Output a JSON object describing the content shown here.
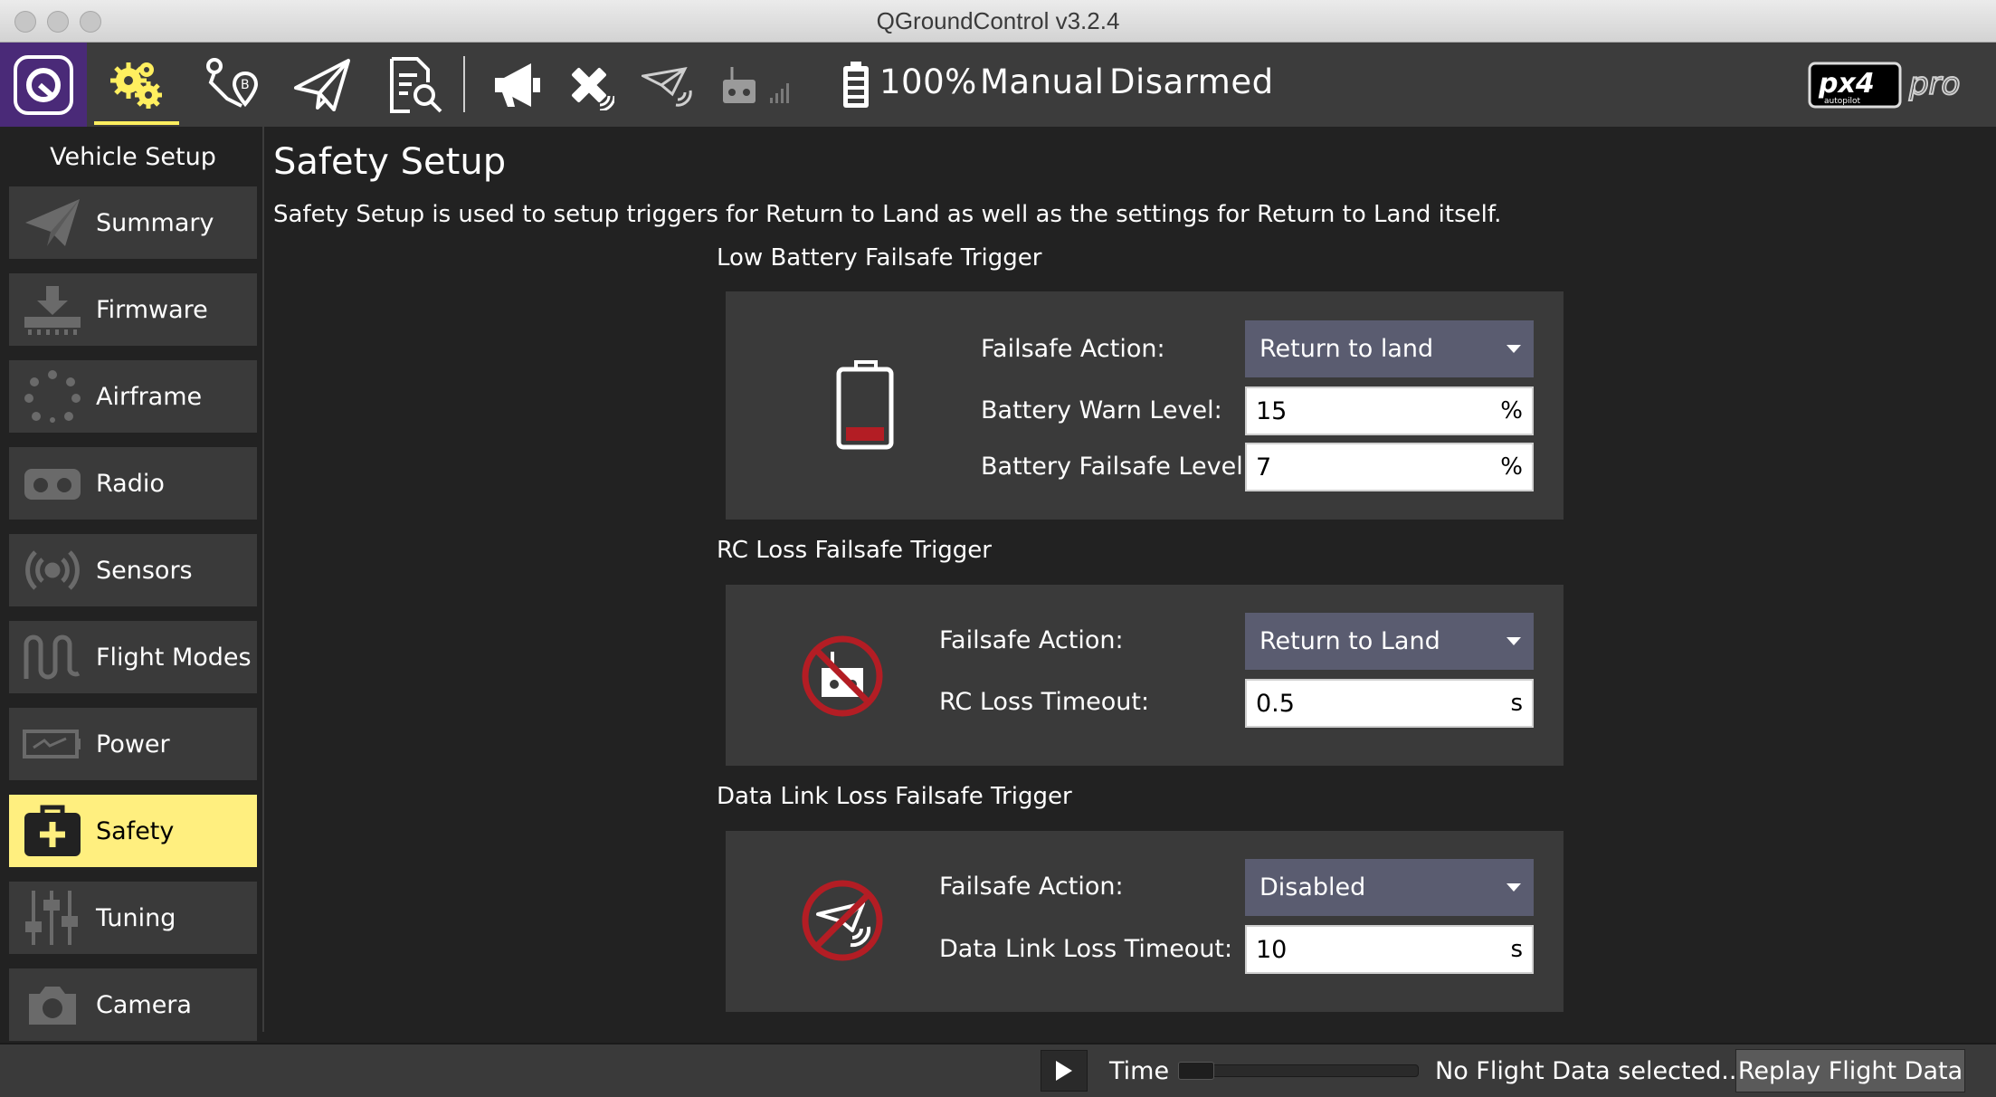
{
  "window": {
    "title": "QGroundControl v3.2.4"
  },
  "toolbar": {
    "battery_percent": "100%",
    "flight_mode": "Manual",
    "arm_state": "Disarmed",
    "brand_logo_text": "px4 autopilot pro",
    "icons": [
      "qgc-logo-icon",
      "vehicle-setup-gears-icon",
      "plan-waypoint-icon",
      "fly-paper-plane-icon",
      "analyze-document-icon",
      "messages-megaphone-icon",
      "gps-satellite-icon",
      "telemetry-plane-icon",
      "rc-transmitter-icon",
      "battery-icon"
    ],
    "accent": "#ffef5f"
  },
  "sidebar": {
    "title": "Vehicle Setup",
    "items": [
      {
        "label": "Summary",
        "icon": "paper-plane-icon"
      },
      {
        "label": "Firmware",
        "icon": "download-chip-icon"
      },
      {
        "label": "Airframe",
        "icon": "airframe-dots-icon"
      },
      {
        "label": "Radio",
        "icon": "radio-transmitter-icon"
      },
      {
        "label": "Sensors",
        "icon": "sensors-waves-icon"
      },
      {
        "label": "Flight Modes",
        "icon": "flight-modes-wave-icon"
      },
      {
        "label": "Power",
        "icon": "power-battery-icon"
      },
      {
        "label": "Safety",
        "icon": "safety-medkit-icon",
        "active": true
      },
      {
        "label": "Tuning",
        "icon": "tuning-sliders-icon"
      },
      {
        "label": "Camera",
        "icon": "camera-icon"
      }
    ],
    "active_color": "#ffef7f"
  },
  "main": {
    "title": "Safety Setup",
    "description": "Safety Setup is used to setup triggers for Return to Land as well as the settings for Return to Land itself.",
    "sections": {
      "battery": {
        "title": "Low Battery Failsafe Trigger",
        "action_label": "Failsafe Action:",
        "action_value": "Return to land",
        "warn_label": "Battery Warn Level:",
        "warn_value": "15",
        "warn_unit": "%",
        "failsafe_label": "Battery Failsafe Level:",
        "failsafe_value": "7",
        "failsafe_unit": "%"
      },
      "rc_loss": {
        "title": "RC Loss Failsafe Trigger",
        "action_label": "Failsafe Action:",
        "action_value": "Return to Land",
        "timeout_label": "RC Loss Timeout:",
        "timeout_value": "0.5",
        "timeout_unit": "s"
      },
      "datalink": {
        "title": "Data Link Loss Failsafe Trigger",
        "action_label": "Failsafe Action:",
        "action_value": "Disabled",
        "timeout_label": "Data Link Loss Timeout:",
        "timeout_value": "10",
        "timeout_unit": "s"
      }
    },
    "colors": {
      "combo_bg": "#5a5c70",
      "panel_bg": "#3a3a3a",
      "warning_red": "#b31d24"
    }
  },
  "bottombar": {
    "time_label": "Time",
    "status": "No Flight Data selected..",
    "replay_button": "Replay Flight Data"
  }
}
